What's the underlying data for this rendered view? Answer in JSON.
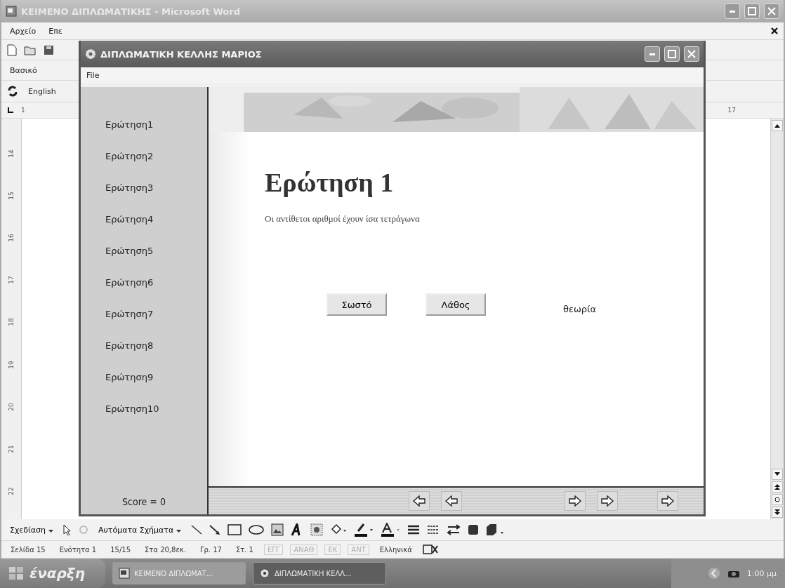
{
  "word": {
    "title": "ΚΕΙΜΕΝΟ ΔΙΠΛΩΜΑΤΙΚΗΣ - Microsoft Word",
    "menu": [
      "Αρχείο",
      "Επε"
    ],
    "style_box": "Βασικό",
    "language": "English",
    "hruler": [
      "1",
      "17"
    ],
    "vruler": [
      "14",
      "15",
      "16",
      "17",
      "18",
      "19",
      "20",
      "21",
      "22"
    ],
    "drawing_toolbar": {
      "draw": "Σχεδίαση",
      "autoshapes": "Αυτόματα Σχήματα"
    },
    "status": [
      {
        "text": "Σελίδα 15",
        "disabled": false
      },
      {
        "text": "Ενότητα 1",
        "disabled": false
      },
      {
        "text": "15/15",
        "disabled": false
      },
      {
        "text": "Στα 20,8εκ.",
        "disabled": false
      },
      {
        "text": "Γρ. 17",
        "disabled": false
      },
      {
        "text": "Στ. 1",
        "disabled": false
      },
      {
        "text": "ΕΓΓ",
        "disabled": true
      },
      {
        "text": "ΑΝΑΘ",
        "disabled": true
      },
      {
        "text": "ΕΚ",
        "disabled": true
      },
      {
        "text": "ΑΝΤ",
        "disabled": true
      },
      {
        "text": "Ελληνικά",
        "disabled": false
      }
    ]
  },
  "app": {
    "title": "ΔΙΠΛΩΜΑΤΙΚΗ  ΚΕΛΛΗΣ ΜΑΡΙΟΣ",
    "menu": [
      "File"
    ],
    "questions": [
      "Ερώτηση1",
      "Ερώτηση2",
      "Ερώτηση3",
      "Ερώτηση4",
      "Ερώτηση5",
      "Ερώτηση6",
      "Ερώτηση7",
      "Ερώτηση8",
      "Ερώτηση9",
      "Ερώτηση10"
    ],
    "score": "Score = 0",
    "heading": "Ερώτηση 1",
    "question_text": "Οι αντίθετοι αριθμοί έχουν ίσα τετράγωνα",
    "buttons": [
      "Σωστό",
      "Λάθος"
    ],
    "theory": "θεωρία"
  },
  "taskbar": {
    "start": "έναρξη",
    "tasks": [
      {
        "label": "ΚΕΙΜΕΝΟ ΔΙΠΛΩΜΑΤ...",
        "kind": "word",
        "selected": false
      },
      {
        "label": "ΔΙΠΛΩΜΑΤΙΚΗ ΚΕΛΛ...",
        "kind": "app",
        "selected": true
      }
    ],
    "clock": "1:00 μμ"
  }
}
